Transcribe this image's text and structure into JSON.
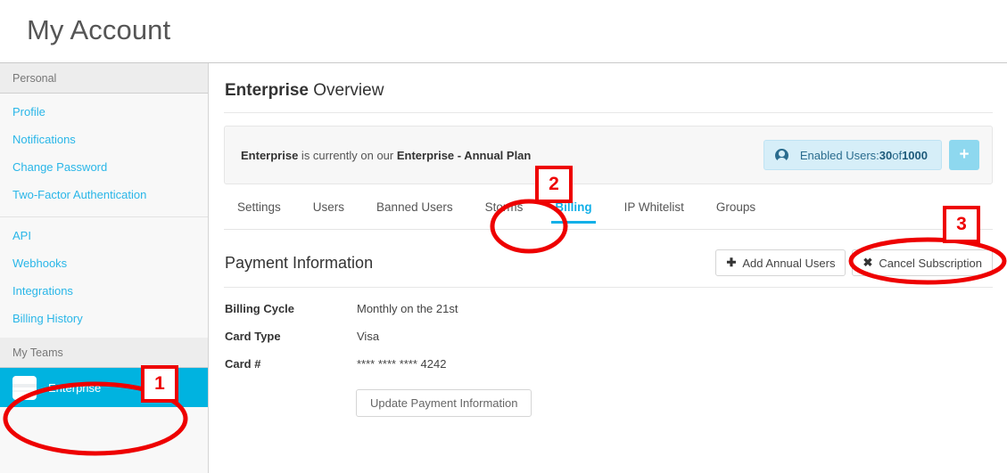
{
  "header": {
    "title": "My Account"
  },
  "sidebar": {
    "sections": [
      {
        "label": "Personal",
        "items": [
          {
            "label": "Profile"
          },
          {
            "label": "Notifications"
          },
          {
            "label": "Change Password"
          },
          {
            "label": "Two-Factor Authentication"
          }
        ]
      },
      {
        "label": "",
        "items": [
          {
            "label": "API"
          },
          {
            "label": "Webhooks"
          },
          {
            "label": "Integrations"
          },
          {
            "label": "Billing History"
          }
        ]
      }
    ],
    "teams_header": "My Teams",
    "team": {
      "name": "Enterprise"
    }
  },
  "main": {
    "overview_title_bold": "Enterprise",
    "overview_title_rest": " Overview",
    "plan_panel": {
      "text_bold_1": "Enterprise",
      "text_mid": " is currently on our ",
      "text_bold_2": "Enterprise - Annual Plan",
      "users_label": "Enabled Users: ",
      "users_current": "30",
      "users_of": " of ",
      "users_max": "1000",
      "add_button_glyph": "+"
    },
    "tabs": [
      {
        "label": "Settings",
        "active": false
      },
      {
        "label": "Users",
        "active": false
      },
      {
        "label": "Banned Users",
        "active": false
      },
      {
        "label": "Storms",
        "active": false
      },
      {
        "label": "Billing",
        "active": true
      },
      {
        "label": "IP Whitelist",
        "active": false
      },
      {
        "label": "Groups",
        "active": false
      }
    ],
    "payment": {
      "title": "Payment Information",
      "add_annual_users_label": "Add Annual Users",
      "add_annual_users_glyph": "✚",
      "cancel_subscription_label": "Cancel Subscription",
      "cancel_subscription_glyph": "✖",
      "rows": [
        {
          "label": "Billing Cycle",
          "value": "Monthly on the 21st"
        },
        {
          "label": "Card Type",
          "value": "Visa"
        },
        {
          "label": "Card #",
          "value": "**** **** **** 4242"
        }
      ],
      "update_button_label": "Update Payment Information"
    }
  },
  "annotations": {
    "color": "#ee0000",
    "markers": [
      {
        "number": "1"
      },
      {
        "number": "2"
      },
      {
        "number": "3"
      }
    ]
  }
}
